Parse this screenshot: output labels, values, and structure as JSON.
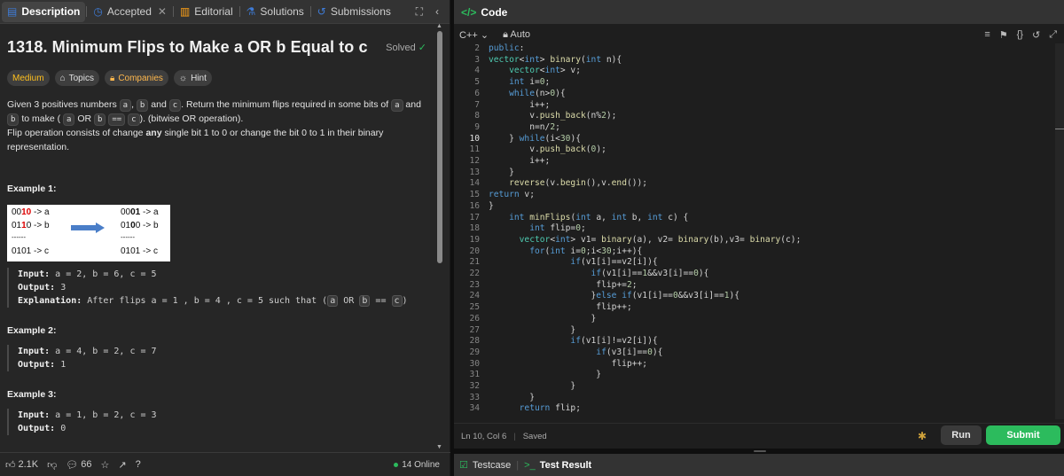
{
  "left_tabs": {
    "description": "Description",
    "accepted": "Accepted",
    "editorial": "Editorial",
    "solutions": "Solutions",
    "submissions": "Submissions"
  },
  "problem": {
    "title": "1318. Minimum Flips to Make a OR b Equal to c",
    "status": "Solved",
    "tags": {
      "difficulty": "Medium",
      "topics": "Topics",
      "companies": "Companies",
      "hint": "Hint"
    },
    "desc_1a": "Given 3 positives numbers",
    "desc_1b": ",",
    "desc_1c": "and",
    "desc_1d": ". Return the minimum flips required in some bits of",
    "desc_1e": "and",
    "desc_1f": "to make (",
    "desc_1g": "OR",
    "desc_1h": "==",
    "desc_1i": "). (bitwise OR operation).",
    "desc_2a": "Flip operation consists of change",
    "desc_2b": "any",
    "desc_2c": "single bit 1 to 0 or change the bit 0 to 1 in their binary representation.",
    "code_a": "a",
    "code_b": "b",
    "code_c": "c",
    "op_or": "OR",
    "op_eq": "=="
  },
  "example1": {
    "heading": "Example 1:",
    "img_left": [
      "0010 -> a",
      "0110 -> b",
      "------",
      "0101 -> c"
    ],
    "img_right": [
      "0001 -> a",
      "0100 -> b",
      "------",
      "0101 -> c"
    ],
    "input_label": "Input:",
    "input": "a = 2, b = 6, c = 5",
    "output_label": "Output:",
    "output": "3",
    "expl_label": "Explanation:",
    "expl": "After flips a = 1 , b = 4 , c = 5 such that (",
    "expl_end": ")"
  },
  "example2": {
    "heading": "Example 2:",
    "input_label": "Input:",
    "input": "a = 4, b = 2, c = 7",
    "output_label": "Output:",
    "output": "1"
  },
  "example3": {
    "heading": "Example 3:",
    "input_label": "Input:",
    "input": "a = 1, b = 2, c = 3",
    "output_label": "Output:",
    "output": "0"
  },
  "left_footer": {
    "likes": "2.1K",
    "comments": "66",
    "online": "14 Online"
  },
  "right": {
    "title": "Code",
    "language": "C++",
    "mode": "Auto",
    "cursor": "Ln 10, Col 6",
    "saved": "Saved",
    "run": "Run",
    "submit": "Submit",
    "testcase": "Testcase",
    "test_result": "Test Result"
  },
  "code_lines": [
    {
      "n": "2",
      "t": "public:"
    },
    {
      "n": "3",
      "t": "vector<int> binary(int n){"
    },
    {
      "n": "4",
      "t": "    vector<int> v;"
    },
    {
      "n": "5",
      "t": "    int i=0;"
    },
    {
      "n": "6",
      "t": "    while(n>0){"
    },
    {
      "n": "7",
      "t": "        i++;"
    },
    {
      "n": "8",
      "t": "        v.push_back(n%2);"
    },
    {
      "n": "9",
      "t": "        n=n/2;"
    },
    {
      "n": "10",
      "t": "    } while(i<30){"
    },
    {
      "n": "11",
      "t": "        v.push_back(0);"
    },
    {
      "n": "12",
      "t": "        i++;"
    },
    {
      "n": "13",
      "t": "    }"
    },
    {
      "n": "14",
      "t": "    reverse(v.begin(),v.end());"
    },
    {
      "n": "15",
      "t": "return v;"
    },
    {
      "n": "16",
      "t": "}"
    },
    {
      "n": "17",
      "t": "    int minFlips(int a, int b, int c) {"
    },
    {
      "n": "18",
      "t": "        int flip=0;"
    },
    {
      "n": "19",
      "t": "      vector<int> v1= binary(a), v2= binary(b),v3= binary(c);"
    },
    {
      "n": "20",
      "t": "        for(int i=0;i<30;i++){"
    },
    {
      "n": "21",
      "t": "                if(v1[i]==v2[i]){"
    },
    {
      "n": "22",
      "t": "                    if(v1[i]==1&&v3[i]==0){"
    },
    {
      "n": "23",
      "t": "                     flip+=2;"
    },
    {
      "n": "24",
      "t": "                    }else if(v1[i]==0&&v3[i]==1){"
    },
    {
      "n": "25",
      "t": "                     flip++;"
    },
    {
      "n": "26",
      "t": "                    }"
    },
    {
      "n": "27",
      "t": "                }"
    },
    {
      "n": "28",
      "t": "                if(v1[i]!=v2[i]){"
    },
    {
      "n": "29",
      "t": "                     if(v3[i]==0){"
    },
    {
      "n": "30",
      "t": "                        flip++;"
    },
    {
      "n": "31",
      "t": "                     }"
    },
    {
      "n": "32",
      "t": "                }"
    },
    {
      "n": "33",
      "t": "        }"
    },
    {
      "n": "34",
      "t": "      return flip;"
    }
  ],
  "current_line": "10",
  "colors": {
    "accent_green": "#2cbb5d",
    "medium": "#ffc01e",
    "tab_active_blue": "#3e7bd6"
  }
}
